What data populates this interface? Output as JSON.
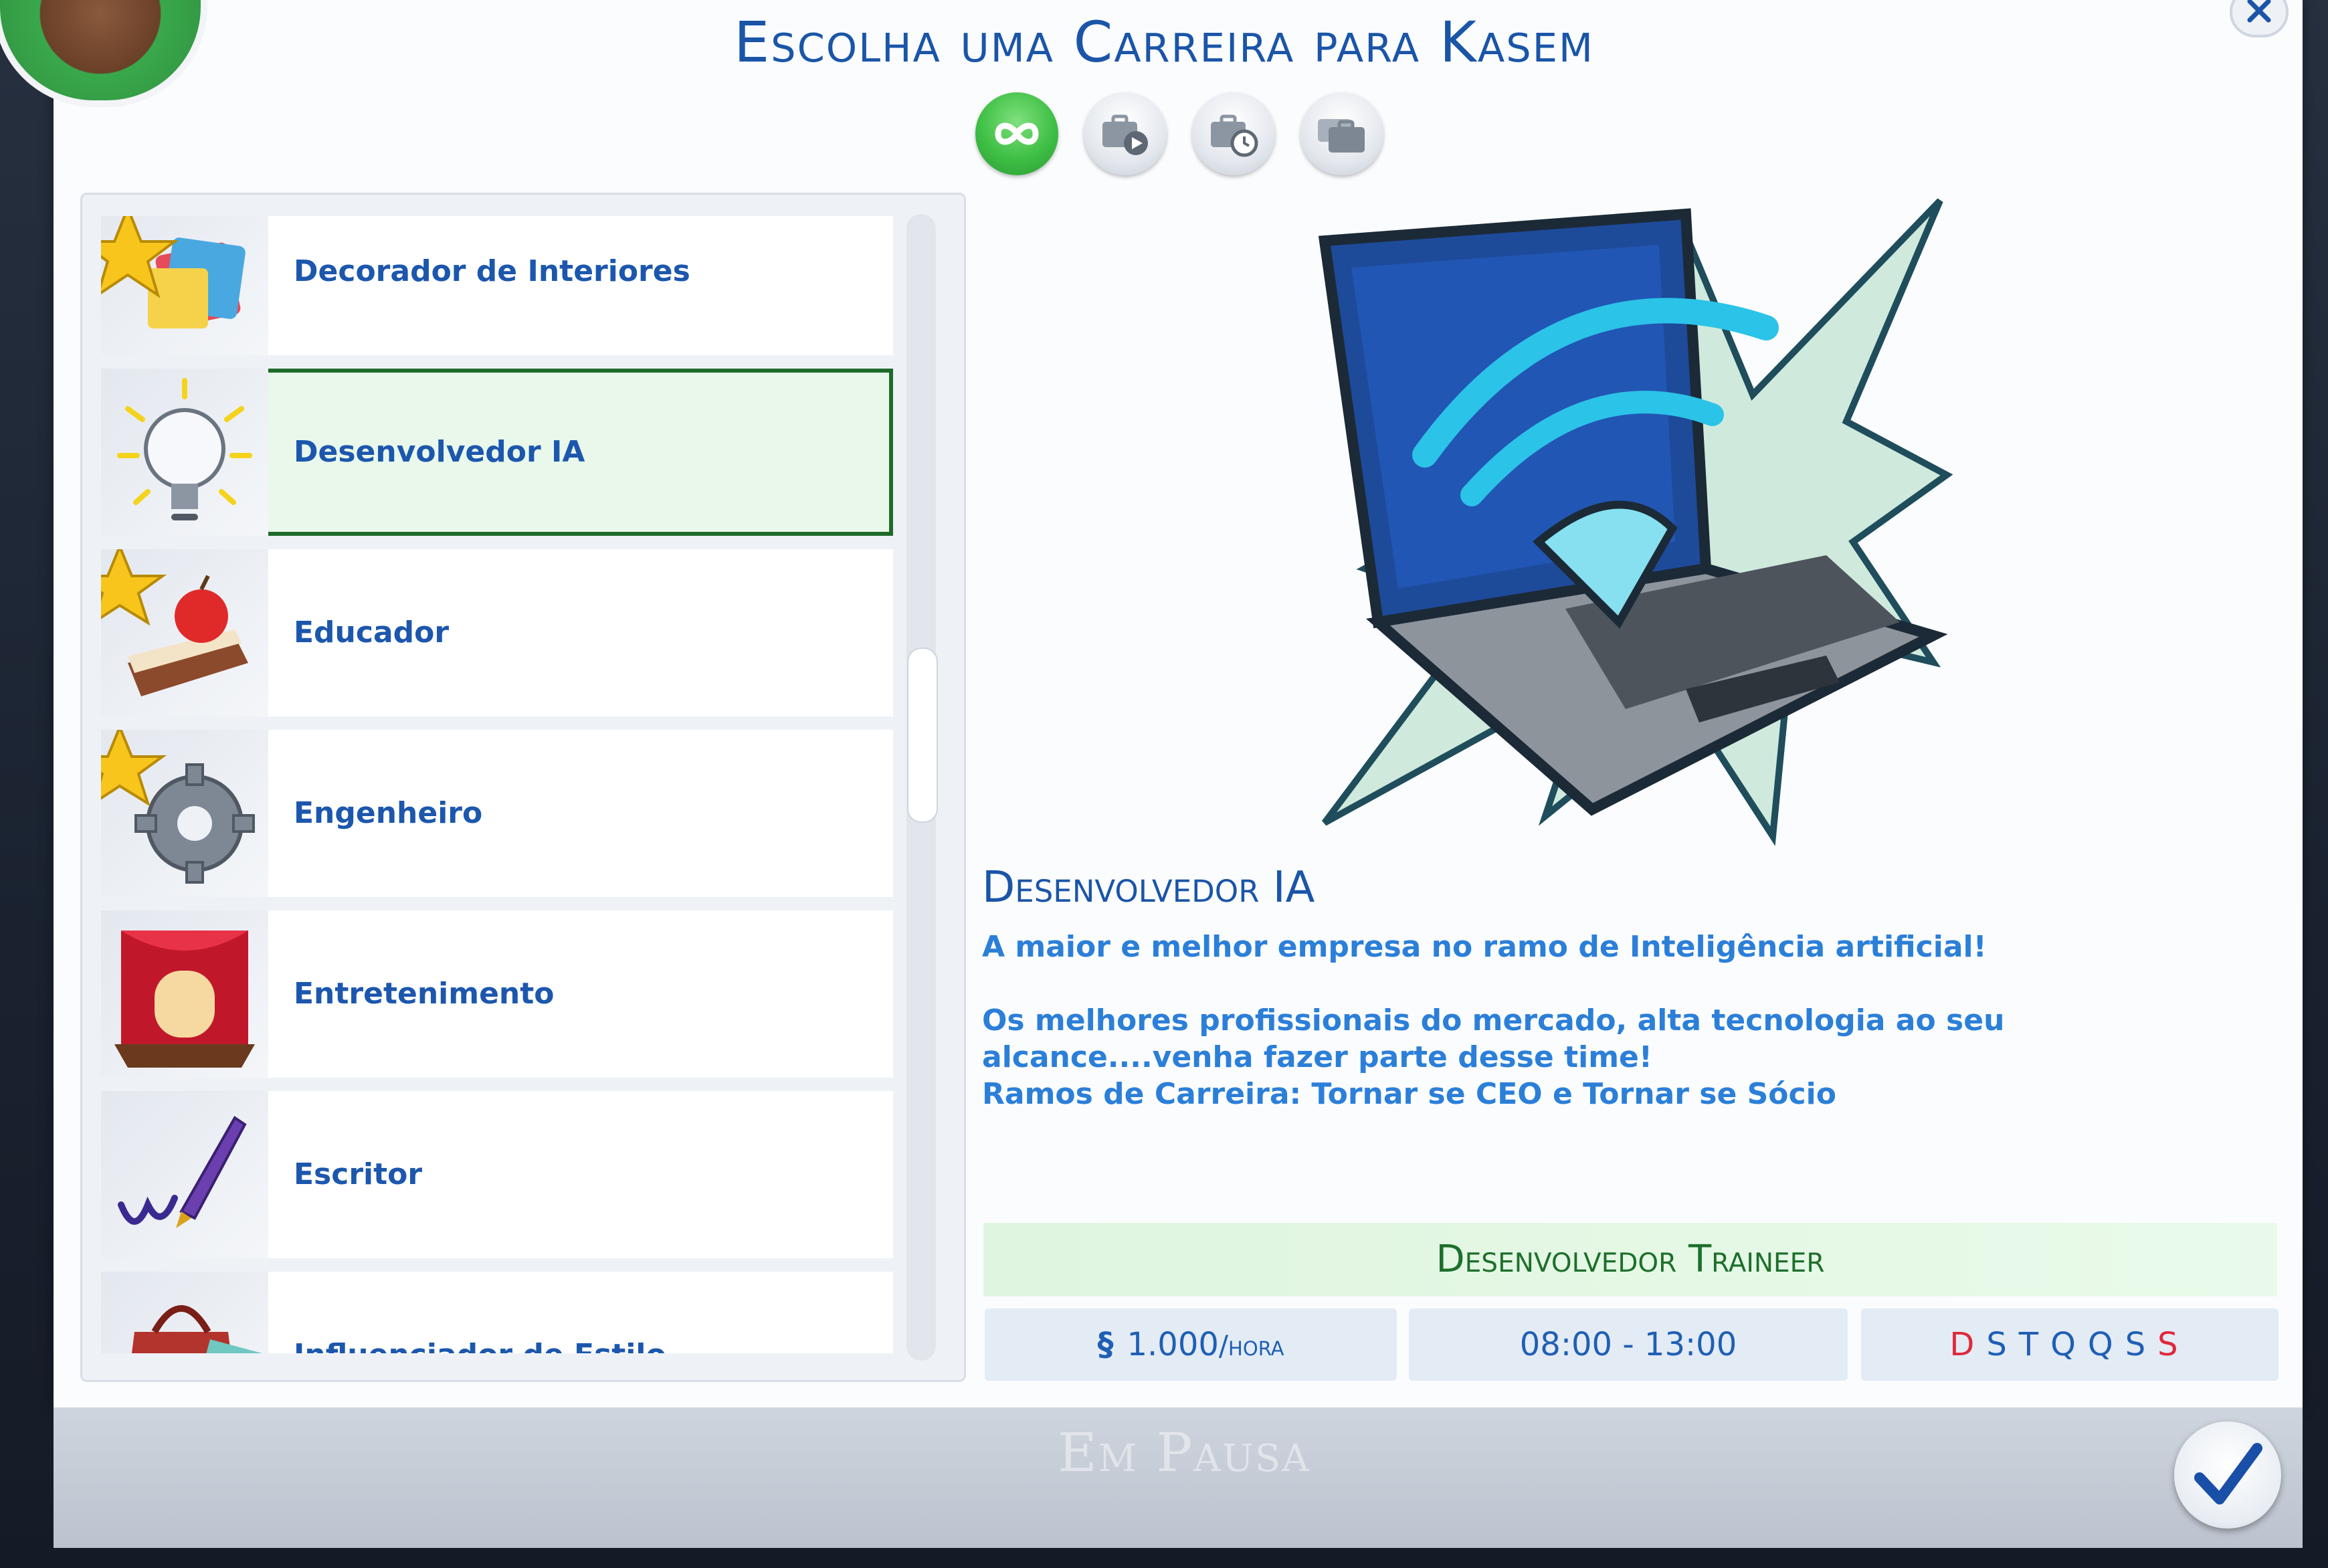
{
  "dialog": {
    "title": "Escolha uma Carreira para Kasem",
    "paused_label": "Em Pausa"
  },
  "filters": [
    {
      "name": "all-careers",
      "icon": "infinity-icon",
      "active": true
    },
    {
      "name": "active-careers",
      "icon": "briefcase-play-icon",
      "active": false
    },
    {
      "name": "part-time",
      "icon": "briefcase-clock-icon",
      "active": false
    },
    {
      "name": "full-time",
      "icon": "briefcase-stack-icon",
      "active": false
    }
  ],
  "careers": [
    {
      "label": "Decorador de Interiores",
      "icon": "paint-swatch-icon"
    },
    {
      "label": "Desenvolvedor IA",
      "icon": "lightbulb-icon",
      "selected": true
    },
    {
      "label": "Educador",
      "icon": "book-apple-icon"
    },
    {
      "label": "Engenheiro",
      "icon": "gear-icon"
    },
    {
      "label": "Entretenimento",
      "icon": "theater-stage-icon"
    },
    {
      "label": "Escritor",
      "icon": "quill-pen-icon"
    },
    {
      "label": "Influenciador de Estilo",
      "icon": "fashion-bag-icon"
    }
  ],
  "detail": {
    "title": "Desenvolvedor IA",
    "line1": "A maior e melhor empresa no ramo de Inteligência artificial!",
    "line2": "Os melhores profissionais do mercado, alta tecnologia ao seu alcance....venha fazer parte desse time!",
    "line3": "Ramos de Carreira: Tornar se CEO  e Tornar se Sócio",
    "level_name": "Desenvolvedor Traineer",
    "pay_symbol": "§",
    "pay_amount": "1.000",
    "pay_unit": "/hora",
    "hours": "08:00 - 13:00",
    "days": [
      {
        "letter": "D",
        "working": false
      },
      {
        "letter": "S",
        "working": true
      },
      {
        "letter": "T",
        "working": true
      },
      {
        "letter": "Q",
        "working": true
      },
      {
        "letter": "Q",
        "working": true
      },
      {
        "letter": "S",
        "working": true
      },
      {
        "letter": "S",
        "working": false
      }
    ]
  },
  "colors": {
    "title_blue": "#1a55a8",
    "selected_outline": "#1f6b2a",
    "day_off_red": "#e0283a",
    "level_green": "#1e6f2b"
  }
}
